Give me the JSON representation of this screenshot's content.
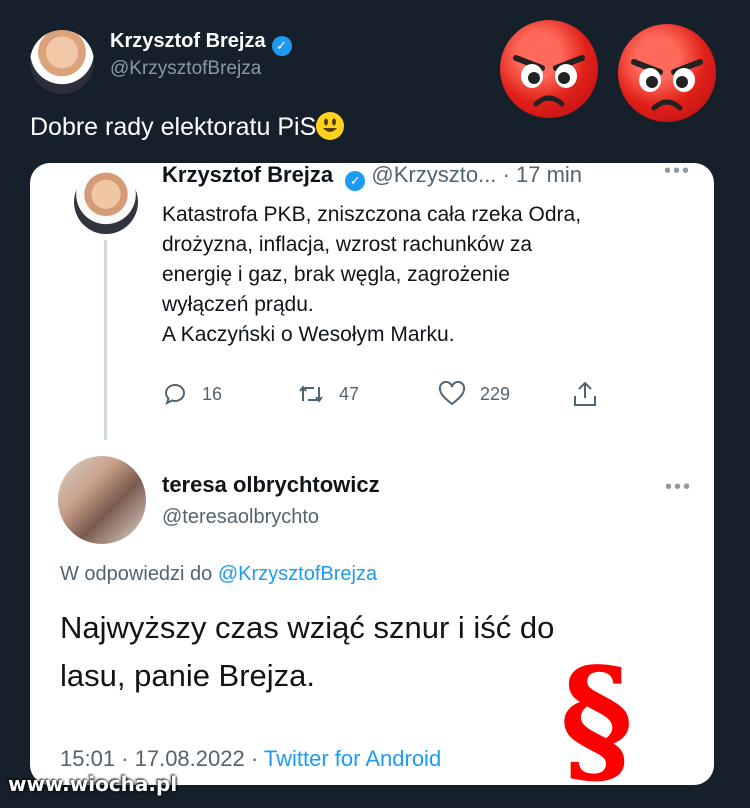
{
  "tweet": {
    "author_name": "Krzysztof Brejza",
    "author_handle": "@KrzysztofBrejza",
    "text": "Dobre rady elektoratu PiS",
    "emoji": "smiling-face-icon"
  },
  "overlay_emojis": [
    "angry-face-icon",
    "angry-face-icon"
  ],
  "quoted": {
    "author_name": "Krzysztof Brejza",
    "handle_truncated": "@Krzyszto...",
    "time": "· 17 min",
    "lines": [
      "Katastrofa PKB, zniszczona cała rzeka Odra,",
      "drożyzna, inflacja, wzrost rachunków za",
      "energię i gaz, brak węgla, zagrożenie",
      "wyłączeń prądu.",
      "A Kaczyński o Wesołym Marku."
    ],
    "replies": "16",
    "retweets": "47",
    "likes": "229"
  },
  "reply": {
    "author_name": "teresa olbrychtowicz",
    "author_handle": "@teresaolbrychto",
    "replying_prefix": "W odpowiedzi do",
    "replying_to": "@KrzysztofBrejza",
    "text_line1": "Najwyższy czas wziąć sznur i iść do",
    "text_line2": "lasu, panie Brejza.",
    "timestamp": "15:01 · 17.08.2022 ·",
    "source": "Twitter for Android"
  },
  "section_sign": "§",
  "watermark": "www.wiocha.pl",
  "colors": {
    "background": "#15202b",
    "link": "#1d9bf0",
    "verified": "#1d9bf0",
    "section": "#ff0000"
  }
}
